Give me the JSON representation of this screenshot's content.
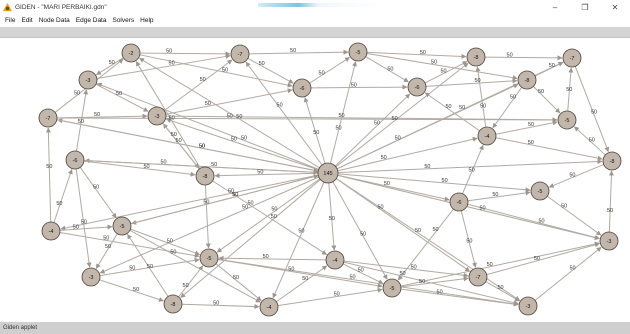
{
  "window": {
    "title": "GIDEN - \"MARI PERBAIKI.gdn\"",
    "minimize_glyph": "–",
    "maximize_glyph": "❐",
    "close_glyph": "✕"
  },
  "menu": [
    "File",
    "Edit",
    "Node Data",
    "Edge Data",
    "Solvers",
    "Help"
  ],
  "status": "Giden applet",
  "colors": {
    "node_fill": "#c3b7ab",
    "node_stroke": "#4a4036",
    "edge": "#b1aaa2",
    "label": "#333333",
    "toolstrip": "#d4d4d4"
  },
  "graph": {
    "edge_weight": "50",
    "nodes": [
      {
        "id": "n1",
        "label": "-2"
      },
      {
        "id": "n2",
        "label": "-7"
      },
      {
        "id": "n3",
        "label": "-5"
      },
      {
        "id": "n4",
        "label": "-8"
      },
      {
        "id": "n5",
        "label": "-7"
      },
      {
        "id": "n6",
        "label": "-3"
      },
      {
        "id": "n7",
        "label": "-6"
      },
      {
        "id": "n8",
        "label": "-6"
      },
      {
        "id": "n9",
        "label": "-8"
      },
      {
        "id": "n10",
        "label": "-7"
      },
      {
        "id": "n11",
        "label": "-3"
      },
      {
        "id": "n12",
        "label": "-4"
      },
      {
        "id": "n13",
        "label": "-5"
      },
      {
        "id": "n14",
        "label": "-6"
      },
      {
        "id": "n15",
        "label": "-8"
      },
      {
        "id": "n16",
        "label": "145"
      },
      {
        "id": "n17",
        "label": "-8"
      },
      {
        "id": "n18",
        "label": "-6"
      },
      {
        "id": "n19",
        "label": "-5"
      },
      {
        "id": "n20",
        "label": "-4"
      },
      {
        "id": "n21",
        "label": "-5"
      },
      {
        "id": "n22",
        "label": "-3"
      },
      {
        "id": "n23",
        "label": "-3"
      },
      {
        "id": "n24",
        "label": "-5"
      },
      {
        "id": "n25",
        "label": "-4"
      },
      {
        "id": "n26",
        "label": "-8"
      },
      {
        "id": "n27",
        "label": "-4"
      },
      {
        "id": "n28",
        "label": "-5"
      },
      {
        "id": "n29",
        "label": "-7"
      },
      {
        "id": "n30",
        "label": "-3"
      }
    ]
  }
}
